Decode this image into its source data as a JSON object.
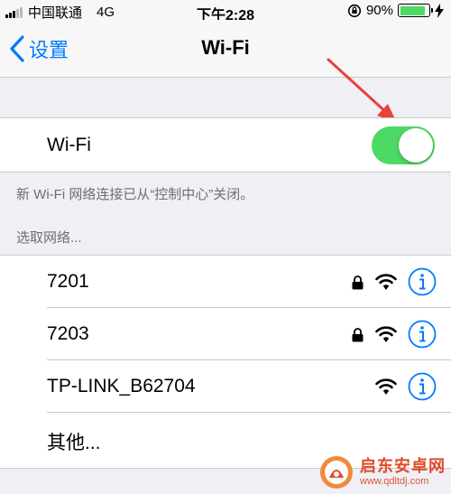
{
  "status_bar": {
    "carrier": "中国联通",
    "network": "4G",
    "time": "下午2:28",
    "battery_percent": "90%",
    "battery_level": 0.9,
    "battery_color": "#4cd964"
  },
  "nav": {
    "back_label": "设置",
    "title": "Wi-Fi"
  },
  "wifi_toggle": {
    "label": "Wi-Fi",
    "enabled": true,
    "on_color": "#4cd964"
  },
  "footer_note": "新 Wi-Fi 网络连接已从“控制中心”关闭。",
  "section_header": "选取网络...",
  "networks": [
    {
      "name": "7201",
      "secured": true,
      "icons": [
        "lock-icon",
        "wifi-icon",
        "info-icon"
      ]
    },
    {
      "name": "7203",
      "secured": true,
      "icons": [
        "lock-icon",
        "wifi-icon",
        "info-icon"
      ]
    },
    {
      "name": "TP-LINK_B62704",
      "secured": false,
      "icons": [
        "wifi-icon",
        "info-icon"
      ]
    },
    {
      "name": "其他..."
    }
  ],
  "watermark": {
    "title": "启东安卓网",
    "url": "www.qdltdj.com"
  },
  "colors": {
    "accent": "#007aff",
    "annotation": "#e8423b"
  }
}
